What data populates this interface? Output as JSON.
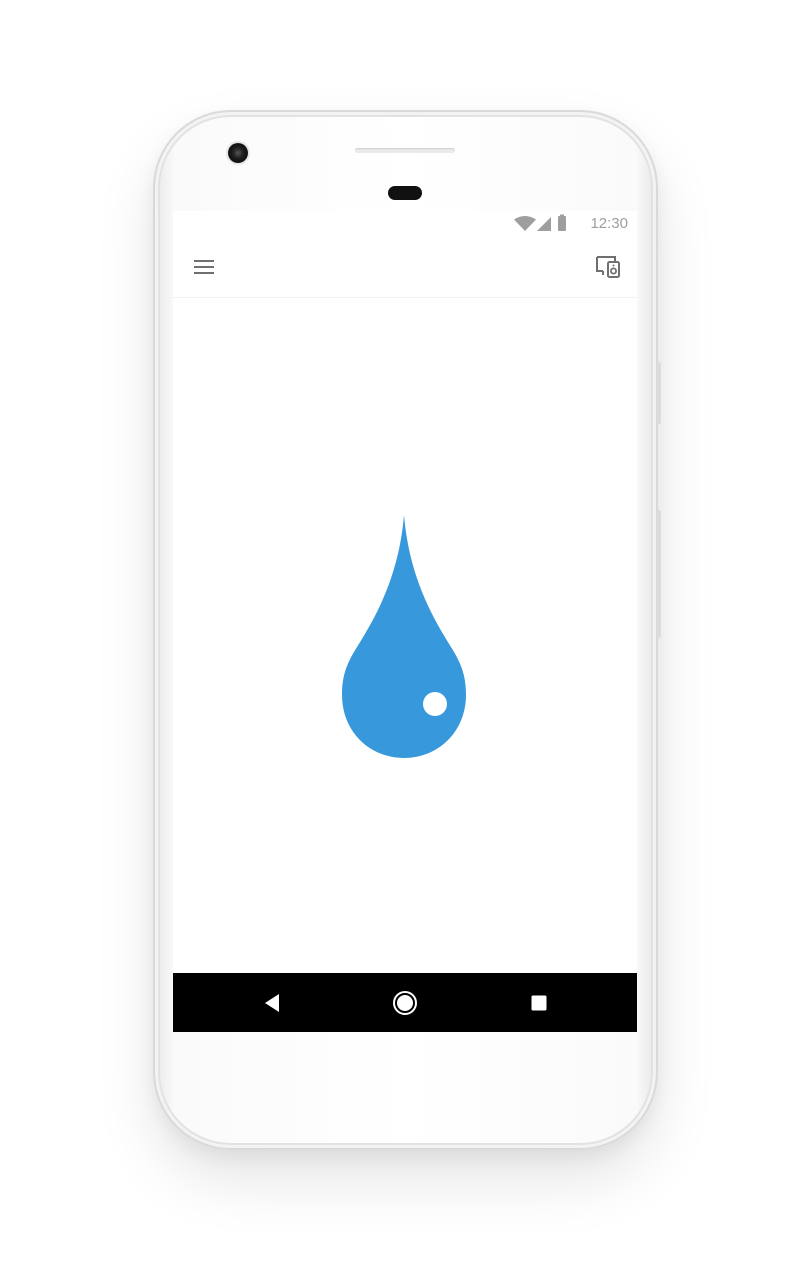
{
  "status_bar": {
    "time": "12:30",
    "icons": [
      "wifi-icon",
      "cellular-signal-icon",
      "battery-icon"
    ]
  },
  "app_bar": {
    "menu_icon": "menu-icon",
    "cast_icon": "cast-device-icon"
  },
  "content": {
    "illustration": "water-drop-icon",
    "accent_color": "#3799DC"
  },
  "nav_bar": {
    "back_icon": "back-icon",
    "home_icon": "home-icon",
    "recents_icon": "recents-icon"
  },
  "colors": {
    "status_text": "#9E9E9E",
    "icon_gray": "#6F6F6F",
    "nav_background": "#000000",
    "drop_blue": "#3799DC"
  }
}
